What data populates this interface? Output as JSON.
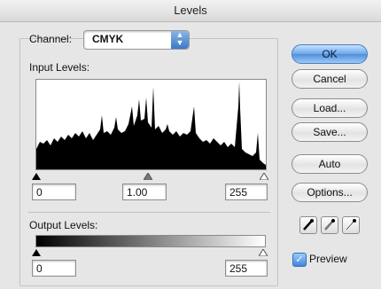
{
  "dialog": {
    "title": "Levels"
  },
  "channel": {
    "label": "Channel:",
    "value": "CMYK"
  },
  "input_levels": {
    "label": "Input Levels:",
    "black": "0",
    "gamma": "1.00",
    "white": "255"
  },
  "output_levels": {
    "label": "Output Levels:",
    "black": "0",
    "white": "255"
  },
  "buttons": {
    "ok": "OK",
    "cancel": "Cancel",
    "load": "Load...",
    "save": "Save...",
    "auto": "Auto",
    "options": "Options..."
  },
  "preview": {
    "label": "Preview",
    "checked": true
  },
  "colors": {
    "accent": "#4f8fdc",
    "histogram": "#000000"
  }
}
